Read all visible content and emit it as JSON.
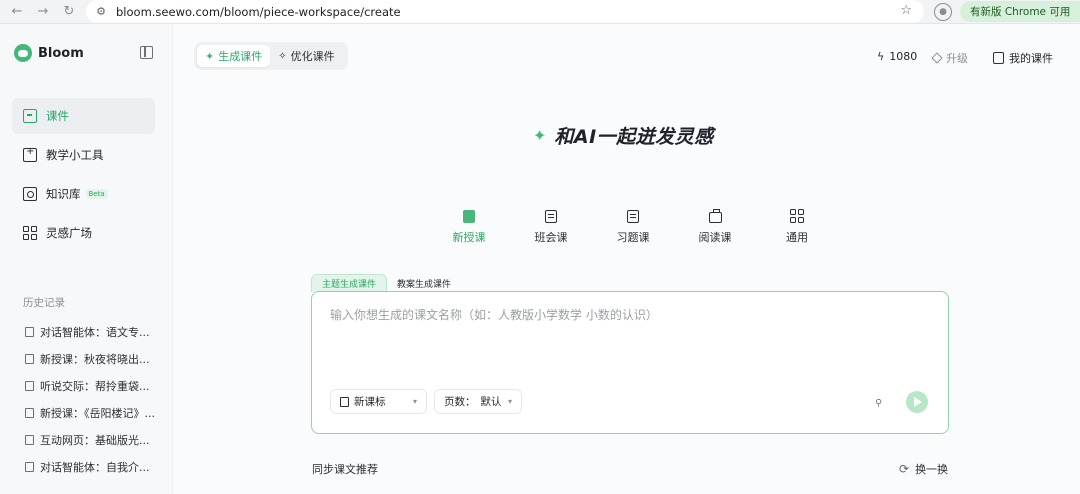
{
  "browser": {
    "url": "bloom.seewo.com/bloom/piece-workspace/create",
    "update_label": "有新版 Chrome 可用"
  },
  "sidebar": {
    "brand": "Bloom",
    "nav": [
      {
        "label": "课件",
        "active": true
      },
      {
        "label": "教学小工具"
      },
      {
        "label": "知识库",
        "badge": "Beta"
      },
      {
        "label": "灵感广场"
      }
    ],
    "history_title": "历史记录",
    "history": [
      "对话智能体：语文专...",
      "新授课：秋夜将晓出...",
      "听说交际：帮拎重袋...",
      "新授课：《岳阳楼记》...",
      "互动网页：基础版光...",
      "对话智能体：自我介..."
    ]
  },
  "main": {
    "modes": [
      {
        "label": "生成课件",
        "active": true
      },
      {
        "label": "优化课件"
      }
    ],
    "credits": "1080",
    "upgrade": "升级",
    "my_courseware": "我的课件",
    "headline": "和AI一起迸发灵感",
    "types": [
      {
        "label": "新授课",
        "active": true,
        "icon": "new-lesson-icon"
      },
      {
        "label": "班会课",
        "icon": "class-meeting-icon"
      },
      {
        "label": "习题课",
        "icon": "exercise-icon"
      },
      {
        "label": "阅读课",
        "icon": "reading-icon"
      },
      {
        "label": "通用",
        "icon": "general-grid-icon"
      }
    ],
    "sub_tabs": [
      {
        "label": "主题生成课件",
        "active": true
      },
      {
        "label": "教案生成课件"
      }
    ],
    "composer": {
      "placeholder": "输入你想生成的课文名称（如：人教版小学数学 小数的认识）",
      "value": "",
      "curriculum": "新课标",
      "pages_label": "页数：",
      "pages_value": "默认"
    },
    "recommend_title": "同步课文推荐",
    "refresh_label": "换一换"
  },
  "colors": {
    "accent": "#2aa866",
    "accent_light": "#e3f5ea",
    "border_focus": "#8fd4ab"
  }
}
